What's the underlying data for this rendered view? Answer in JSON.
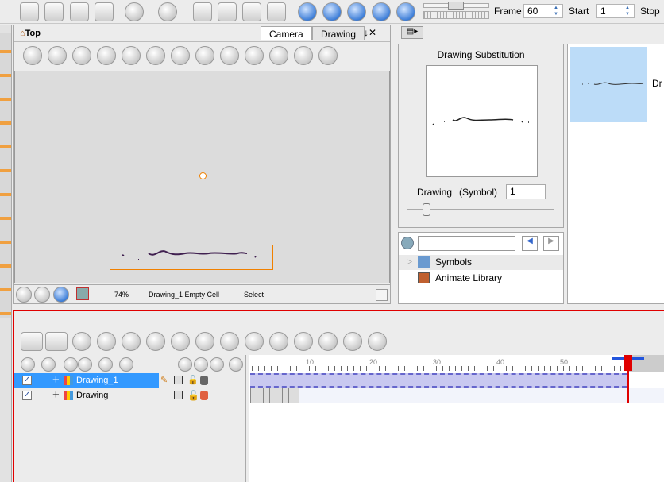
{
  "toolbar": {
    "frame_label": "Frame",
    "frame_value": "60",
    "start_label": "Start",
    "start_value": "1",
    "stop_label": "Stop"
  },
  "camera_view": {
    "location": "Top",
    "tabs": [
      {
        "label": "Camera"
      },
      {
        "label": "Drawing"
      }
    ],
    "status": {
      "zoom": "74%",
      "drawing": "Drawing_1 Empty Cell",
      "tool": "Select"
    }
  },
  "drawing_substitution": {
    "title": "Drawing Substitution",
    "drawing_label": "Drawing",
    "symbol_label": "(Symbol)",
    "value": "1"
  },
  "library": {
    "search_placeholder": "",
    "items": [
      {
        "label": "Symbols"
      },
      {
        "label": "Animate Library"
      }
    ]
  },
  "thumbnail": {
    "label": "Dr"
  },
  "timeline": {
    "layers": [
      {
        "name": "Drawing_1",
        "selected": true
      },
      {
        "name": "Drawing",
        "selected": false
      }
    ],
    "ruler": [
      "10",
      "20",
      "30",
      "40",
      "50"
    ],
    "current_frame": 60
  },
  "colors": {
    "selection": "#3399ff",
    "playhead": "#e00000",
    "accent": "#f08000"
  }
}
